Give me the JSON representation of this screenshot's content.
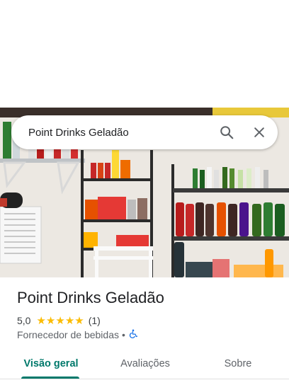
{
  "search": {
    "query": "Point Drinks Geladão"
  },
  "place": {
    "name": "Point Drinks Geladão",
    "rating": "5,0",
    "stars": 5,
    "review_count": "(1)",
    "category": "Fornecedor de bebidas",
    "separator": "•"
  },
  "tabs": [
    {
      "label": "Visão geral",
      "active": true
    },
    {
      "label": "Avaliações",
      "active": false
    },
    {
      "label": "Sobre",
      "active": false
    }
  ],
  "colors": {
    "accent": "#00796b",
    "star": "#fbbc04",
    "accessible_icon": "#1a73e8"
  },
  "icons": {
    "search": "search-icon",
    "close": "close-icon",
    "wheelchair": "wheelchair-icon"
  }
}
